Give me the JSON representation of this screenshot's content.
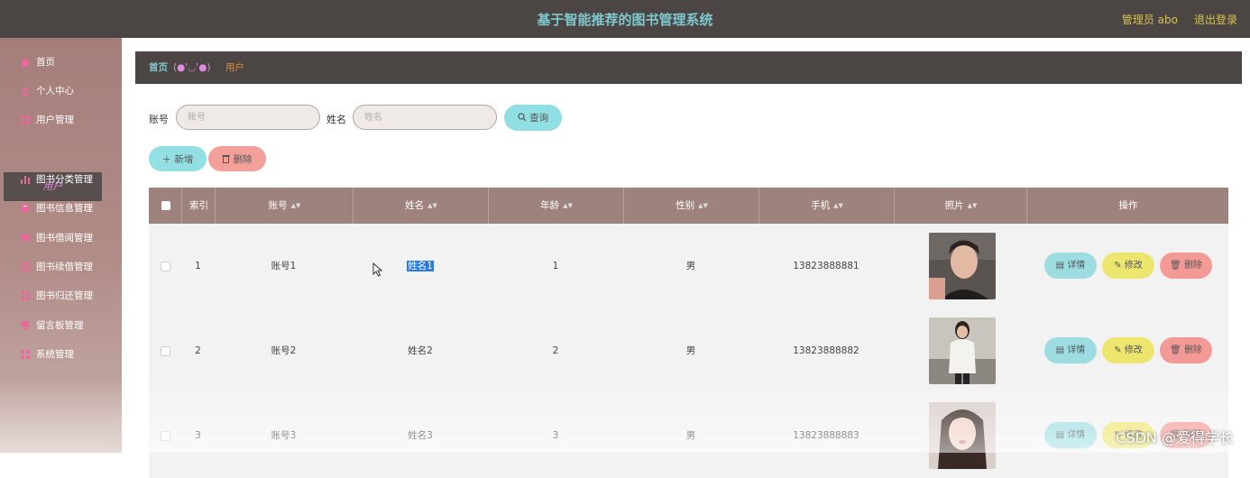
{
  "header": {
    "title": "基于智能推荐的图书管理系统",
    "admin": "管理员 abo",
    "logout": "退出登录"
  },
  "sidebar": {
    "items": [
      {
        "label": "首页",
        "icon": "home-icon"
      },
      {
        "label": "个人中心",
        "icon": "user-icon"
      },
      {
        "label": "用户管理",
        "icon": "grid-icon"
      },
      {
        "label": "图书分类管理",
        "icon": "bar-chart-icon"
      },
      {
        "label": "图书信息管理",
        "icon": "book-icon"
      },
      {
        "label": "图书借阅管理",
        "icon": "chat-icon"
      },
      {
        "label": "图书续借管理",
        "icon": "grid-icon"
      },
      {
        "label": "图书归还管理",
        "icon": "grid-icon"
      },
      {
        "label": "留言板管理",
        "icon": "trophy-icon"
      },
      {
        "label": "系统管理",
        "icon": "grid-icon"
      }
    ],
    "active_sub": "用户"
  },
  "breadcrumb": {
    "home": "首页",
    "separator": "(●'◡'●)",
    "current": "用户"
  },
  "search": {
    "account_label": "账号",
    "account_placeholder": "账号",
    "name_label": "姓名",
    "name_placeholder": "姓名",
    "query_button": "查询"
  },
  "actions": {
    "add": "新增",
    "delete": "删除"
  },
  "table": {
    "headers": [
      "索引",
      "账号",
      "姓名",
      "年龄",
      "性别",
      "手机",
      "照片",
      "操作"
    ],
    "rows": [
      {
        "index": "1",
        "account": "账号1",
        "name": "姓名1",
        "age": "1",
        "gender": "男",
        "phone": "13823888881"
      },
      {
        "index": "2",
        "account": "账号2",
        "name": "姓名2",
        "age": "2",
        "gender": "男",
        "phone": "13823888882"
      },
      {
        "index": "3",
        "account": "账号3",
        "name": "姓名3",
        "age": "3",
        "gender": "男",
        "phone": "13823888883"
      }
    ],
    "row_actions": {
      "detail": "详情",
      "edit": "修改",
      "delete": "删除"
    }
  },
  "watermark": "CSDN @爱得学长",
  "colors": {
    "header_bg": "#4b4543",
    "sidebar_bg": "#a57e7a",
    "accent_teal": "#7ec8ce",
    "table_head": "#9e827e"
  }
}
